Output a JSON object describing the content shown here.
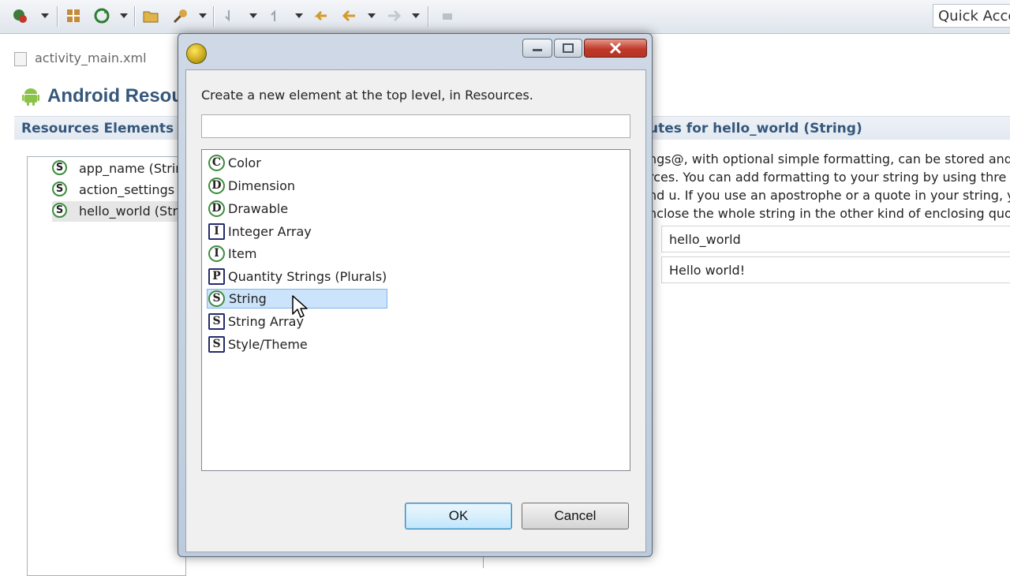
{
  "toolbar": {
    "quick_access": "Quick Acce"
  },
  "editor": {
    "tab_label": "activity_main.xml",
    "title": "Android Resou",
    "left_section": "Resources Elements",
    "right_section": "utes for hello_world (String)",
    "resources": [
      {
        "icon": "S",
        "label": "app_name (Strin"
      },
      {
        "icon": "S",
        "label": "action_settings"
      },
      {
        "icon": "S",
        "label": "hello_world (Str"
      }
    ],
    "description_lines": [
      "ngs@, with optional simple formatting, can be stored and",
      "rces. You can add formatting to your string by using thre",
      "nd u. If you use an apostrophe or a quote in your string, y",
      "nclose the whole string in the other kind of enclosing quo"
    ],
    "name_value": "hello_world",
    "value_value": "Hello world!"
  },
  "dialog": {
    "prompt": "Create a new element at the top level, in Resources.",
    "filter_value": "",
    "options": [
      {
        "label": "Color",
        "icon": "C",
        "shape": "round"
      },
      {
        "label": "Dimension",
        "icon": "D",
        "shape": "round"
      },
      {
        "label": "Drawable",
        "icon": "D",
        "shape": "round"
      },
      {
        "label": "Integer Array",
        "icon": "I",
        "shape": "square"
      },
      {
        "label": "Item",
        "icon": "I",
        "shape": "round"
      },
      {
        "label": "Quantity Strings (Plurals)",
        "icon": "P",
        "shape": "square"
      },
      {
        "label": "String",
        "icon": "S",
        "shape": "round",
        "selected": true
      },
      {
        "label": "String Array",
        "icon": "S",
        "shape": "square"
      },
      {
        "label": "Style/Theme",
        "icon": "S",
        "shape": "square"
      }
    ],
    "ok_label": "OK",
    "cancel_label": "Cancel"
  },
  "colors": {
    "accent": "#35577b",
    "selection": "#cce4fb",
    "round_icon_border": "#3a8c3a",
    "square_icon_border": "#232c6b"
  }
}
